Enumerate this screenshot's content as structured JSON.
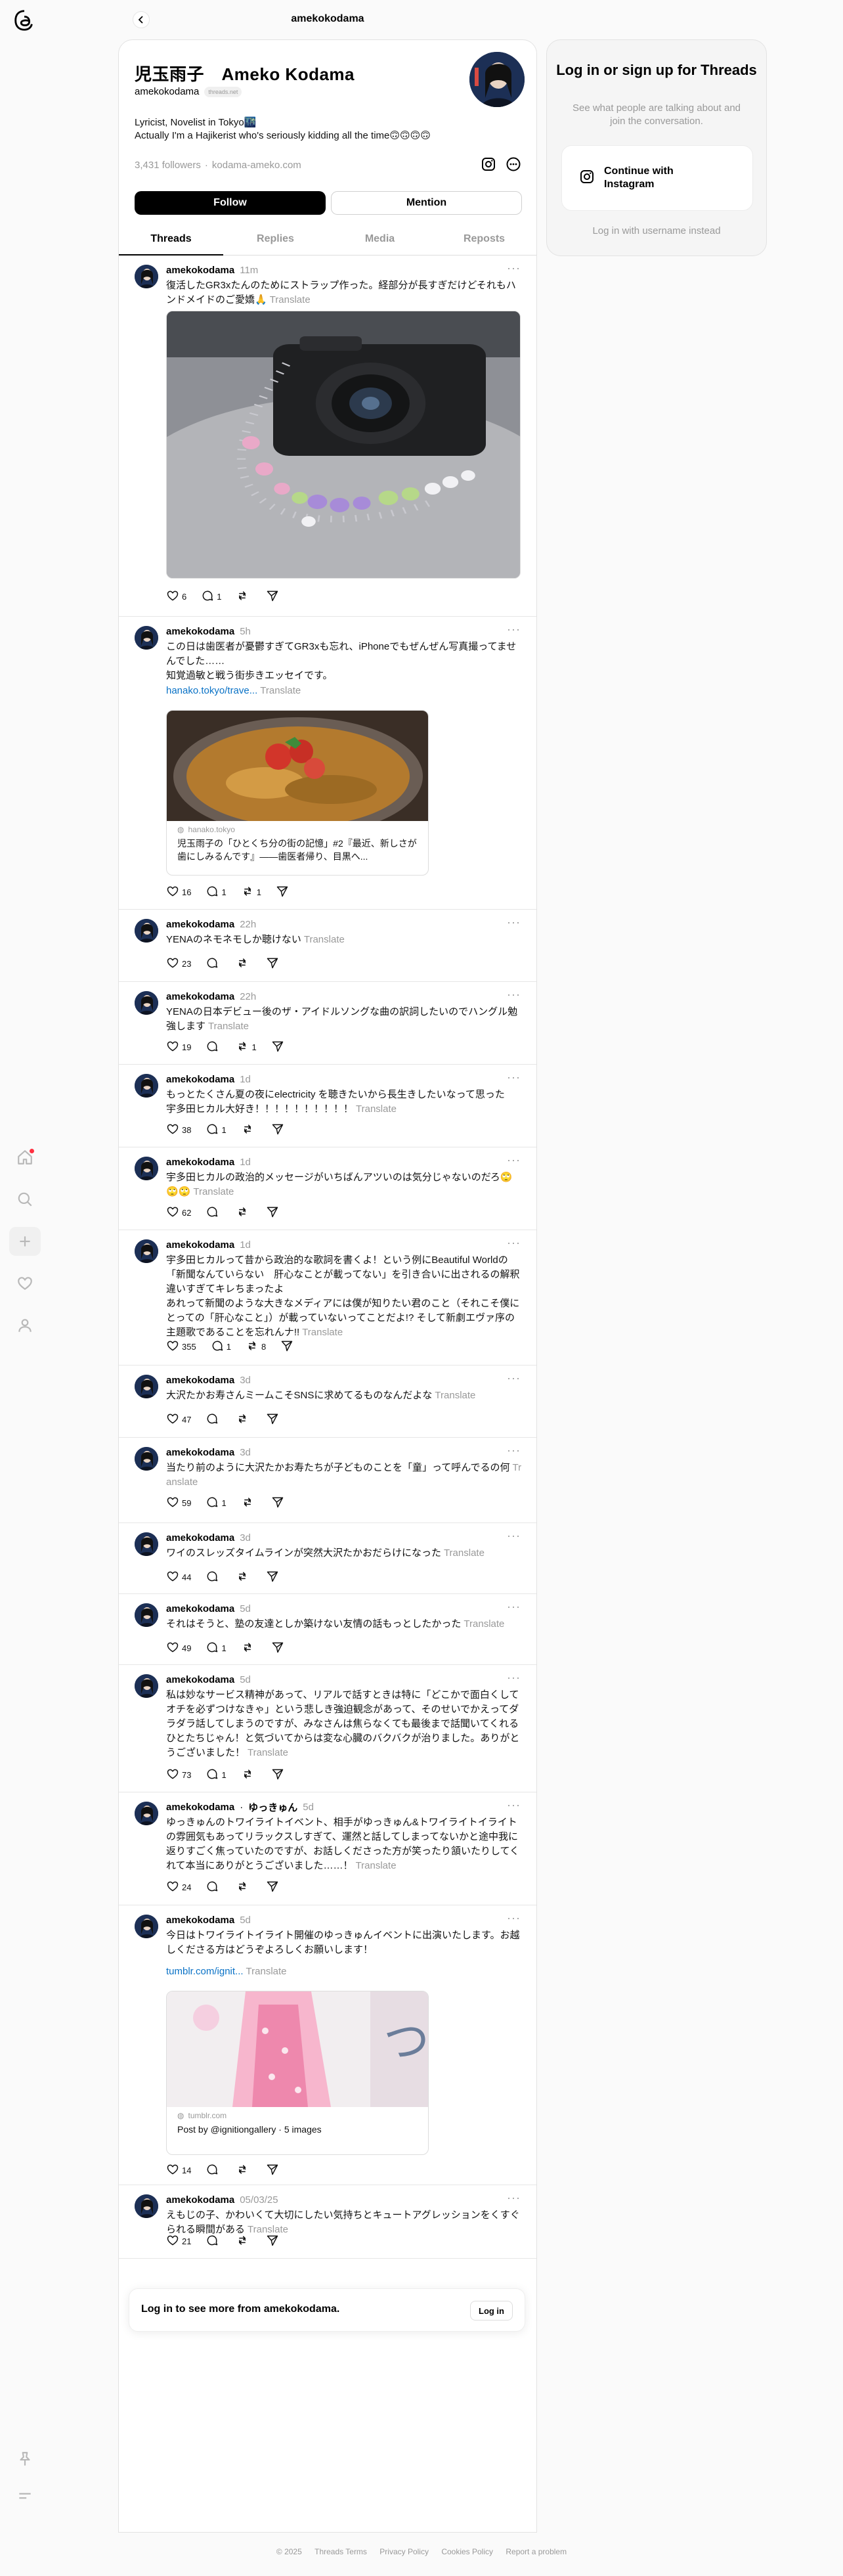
{
  "top": {
    "title": "amekokodama"
  },
  "profile": {
    "name": "児玉雨子　Ameko Kodama",
    "handle": "amekokodama",
    "badge": "threads.net",
    "bio_line1": "Lyricist, Novelist in Tokyo🌃",
    "bio_line2": "Actually I'm a Hajikerist who's seriously kidding all the time🙃🙃🙃🙃",
    "followers": "3,431 followers",
    "separator": "·",
    "website": "kodama-ameko.com",
    "follow_label": "Follow",
    "mention_label": "Mention"
  },
  "tabs": [
    "Threads",
    "Replies",
    "Media",
    "Reposts"
  ],
  "posts": [
    {
      "user": "amekokodama",
      "time": "11m",
      "text": "復活したGR3xたんのためにストラップ作った。経部分が長すぎだけどそれもハンドメイドのご愛嬌🙏",
      "translate": "Translate",
      "likes": "6",
      "replies": "1",
      "reposts": ""
    },
    {
      "user": "amekokodama",
      "time": "5h",
      "text": "この日は歯医者が憂鬱すぎてGR3xも忘れ、iPhoneでもぜんぜん写真撮ってませんでした……\n知覚過敏と戦う街歩きエッセイです。",
      "link": "hanako.tokyo/trave...",
      "translate": "Translate",
      "card_source": "hanako.tokyo",
      "card_title": "児玉雨子の「ひとくち分の街の記憶」#2『最近、新しさが歯にしみるんです』——歯医者帰り、目黒へ...",
      "likes": "16",
      "replies": "1",
      "reposts": "1"
    },
    {
      "user": "amekokodama",
      "time": "22h",
      "text": "YENAのネモネモしか聴けない",
      "translate": "Translate",
      "likes": "23",
      "replies": "",
      "reposts": ""
    },
    {
      "user": "amekokodama",
      "time": "22h",
      "text": "YENAの日本デビュー後のザ・アイドルソングな曲の訳詞したいのでハングル勉強します",
      "translate": "Translate",
      "likes": "19",
      "replies": "",
      "reposts": "1"
    },
    {
      "user": "amekokodama",
      "time": "1d",
      "text": "もっとたくさん夏の夜にelectricity を聴きたいから長生きしたいなって思った　宇多田ヒカル大好き！！！！！！！！！！",
      "translate": "Translate",
      "likes": "38",
      "replies": "1",
      "reposts": ""
    },
    {
      "user": "amekokodama",
      "time": "1d",
      "text": "宇多田ヒカルの政治的メッセージがいちばんアツいのは気分じゃないのだろ🙄🙄🙄",
      "translate": "Translate",
      "likes": "62",
      "replies": "",
      "reposts": ""
    },
    {
      "user": "amekokodama",
      "time": "1d",
      "text": "宇多田ヒカルって昔から政治的な歌詞を書くよ！という例にBeautiful Worldの「新聞なんていらない　肝心なことが載ってない」を引き合いに出されるの解釈違いすぎてキレちまったよ\nあれって新聞のような大きなメディアには僕が知りたい君のこと（それこそ僕にとっての「肝心なこと」）が載っていないってことだよ!? そして新劇エヴァ序の主題歌であることを忘れんナ!!",
      "translate": "Translate",
      "likes": "355",
      "replies": "1",
      "reposts": "8"
    },
    {
      "user": "amekokodama",
      "time": "3d",
      "text": "大沢たかお寿さんミームこそSNSに求めてるものなんだよな",
      "translate": "Translate",
      "likes": "47",
      "replies": "",
      "reposts": ""
    },
    {
      "user": "amekokodama",
      "time": "3d",
      "text": "当たり前のように大沢たかお寿たちが子どものことを「童」って呼んでるの何",
      "translate": "Translate",
      "likes": "59",
      "replies": "1",
      "reposts": ""
    },
    {
      "user": "amekokodama",
      "time": "3d",
      "text": "ワイのスレッズタイムラインが突然大沢たかおだらけになった",
      "translate": "Translate",
      "likes": "44",
      "replies": "",
      "reposts": ""
    },
    {
      "user": "amekokodama",
      "time": "5d",
      "text": "それはそうと、塾の友達としか築けない友情の話もっとしたかった",
      "translate": "Translate",
      "likes": "49",
      "replies": "1",
      "reposts": ""
    },
    {
      "user": "amekokodama",
      "time": "5d",
      "text": "私は妙なサービス精神があって、リアルで話すときは特に「どこかで面白くしてオチを必ずつけなきゃ」という悲しき強迫観念があって、そのせいでかえってダラダラ話してしまうのですが、みなさんは焦らなくても最後まで話聞いてくれるひとたちじゃん！と気づいてからは変な心臓のバクバクが治りました。ありがとうございました！",
      "translate": "Translate",
      "likes": "73",
      "replies": "1",
      "reposts": ""
    },
    {
      "user": "amekokodama",
      "coauthor": "ゆっきゅん",
      "time": "5d",
      "text": "ゆっきゅんのトワイライトイベント、相手がゆっきゅん&トワイライトイライトの雰囲気もあってリラックスしすぎて、運然と話してしまってないかと途中我に返りすごく焦っていたのですが、お話しくださった方が笑ったり頷いたりしてくれて本当にありがとうございました……！",
      "translate": "Translate",
      "likes": "24",
      "replies": "",
      "reposts": ""
    },
    {
      "user": "amekokodama",
      "time": "5d",
      "text": "今日はトワイライトイライト開催のゆっきゅんイベントに出演いたします。お越しくださる方はどうぞよろしくお願いします！",
      "link": "tumblr.com/ignit...",
      "translate": "Translate",
      "card_source": "tumblr.com",
      "card_title": "Post by @ignitiongallery · 5 images",
      "likes": "14",
      "replies": "",
      "reposts": ""
    },
    {
      "user": "amekokodama",
      "time": "05/03/25",
      "text": "えもじの子、かわいくて大切にしたい気持ちとキュートアグレッションをくすぐられる瞬間がある",
      "translate": "Translate",
      "likes": "21",
      "replies": "",
      "reposts": ""
    }
  ],
  "signup": {
    "title": "Log in or sign up for Threads",
    "subtitle": "See what people are talking about and join the conversation.",
    "button": "Continue with Instagram",
    "link": "Log in with username instead"
  },
  "loginbar": {
    "text": "Log in to see more from amekokodama.",
    "button": "Log in"
  },
  "footer": [
    "© 2025",
    "Threads Terms",
    "Privacy Policy",
    "Cookies Policy",
    "Report a problem"
  ],
  "icons": [
    "threads-logo-icon",
    "home-icon",
    "search-icon",
    "plus-icon",
    "heart-icon",
    "user-icon",
    "pin-icon",
    "menu-icon",
    "back-arrow-icon",
    "instagram-icon",
    "more-circle-icon",
    "like-icon",
    "reply-icon",
    "repost-icon",
    "share-icon"
  ],
  "colors": {
    "accent": "#000000",
    "muted": "#999999",
    "link": "#0a72c6",
    "notification": "#ff3040"
  }
}
